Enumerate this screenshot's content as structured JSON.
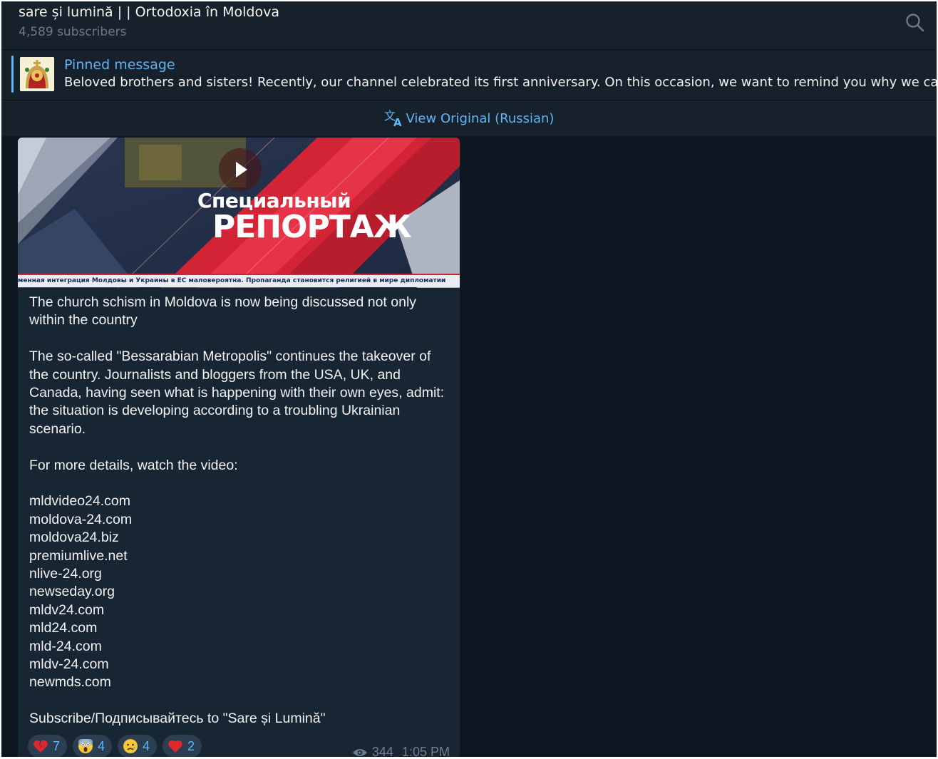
{
  "header": {
    "title": "sare și lumină | | Ortodoxia în Moldova",
    "subtitle": "4,589 subscribers",
    "search_icon": "search-icon"
  },
  "pinned": {
    "label": "Pinned message",
    "text": "Beloved brothers and sisters!  Recently, our channel celebrated its first anniversary. On this occasion, we want to remind you why we call our"
  },
  "translate": {
    "label": "View Original (Russian)",
    "icon": "translate-icon"
  },
  "video": {
    "title_line1": "Специальный",
    "title_line2": "РЕПОРТАЖ",
    "ticker": "менная интеграция Молдовы и Украины в ЕС маловероятна. Пропаганда становится религией в мире дипломатии"
  },
  "message": {
    "para1": [
      "The church schism in Moldova is now being discussed not only",
      "within the country"
    ],
    "para2": [
      "The so-called \"Bessarabian Metropolis\" continues the takeover of",
      "the country. Journalists and bloggers from the USA, UK, and",
      "Canada, having seen what is happening with their own eyes, admit:",
      "the situation is developing according to a troubling Ukrainian",
      "scenario."
    ],
    "para3": "For more details, watch the video:",
    "links": [
      "mldvideo24.com",
      "moldova-24.com",
      "moldova24.biz",
      "premiumlive.net",
      "nlive-24.org",
      "newseday.org",
      "mldv24.com",
      "mld24.com",
      "mld-24.com",
      "mldv-24.com",
      "newmds.com"
    ],
    "subscribe": "Subscribe/Подписывайтесь to \"Sare și Lumină\""
  },
  "reactions": [
    {
      "emoji": "broken-heart-icon",
      "count": "7"
    },
    {
      "emoji": "screaming-face-icon",
      "count": "4"
    },
    {
      "emoji": "sad-face-icon",
      "count": "4"
    },
    {
      "emoji": "red-heart-icon",
      "count": "2"
    }
  ],
  "meta": {
    "views": "344",
    "time": "1:05 PM"
  },
  "colors": {
    "accent": "#5eb5f7",
    "background": "#0e1621",
    "panel": "#17212b",
    "bubble": "#182533"
  }
}
